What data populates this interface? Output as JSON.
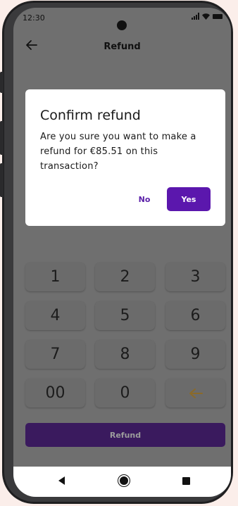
{
  "status_bar": {
    "time": "12:30"
  },
  "app_bar": {
    "title": "Refund"
  },
  "dialog": {
    "title": "Confirm refund",
    "message": "Are you sure you want to make a refund for €85.51 on this transaction?",
    "no_label": "No",
    "yes_label": "Yes"
  },
  "keypad": {
    "keys": [
      "1",
      "2",
      "3",
      "4",
      "5",
      "6",
      "7",
      "8",
      "9",
      "00",
      "0"
    ],
    "backspace_icon": "arrow-left-icon",
    "backspace_color": "#8a6a2a"
  },
  "refund_button": {
    "label": "Refund"
  },
  "colors": {
    "accent": "#5b17ad",
    "overlay": "#6f6f6f"
  }
}
